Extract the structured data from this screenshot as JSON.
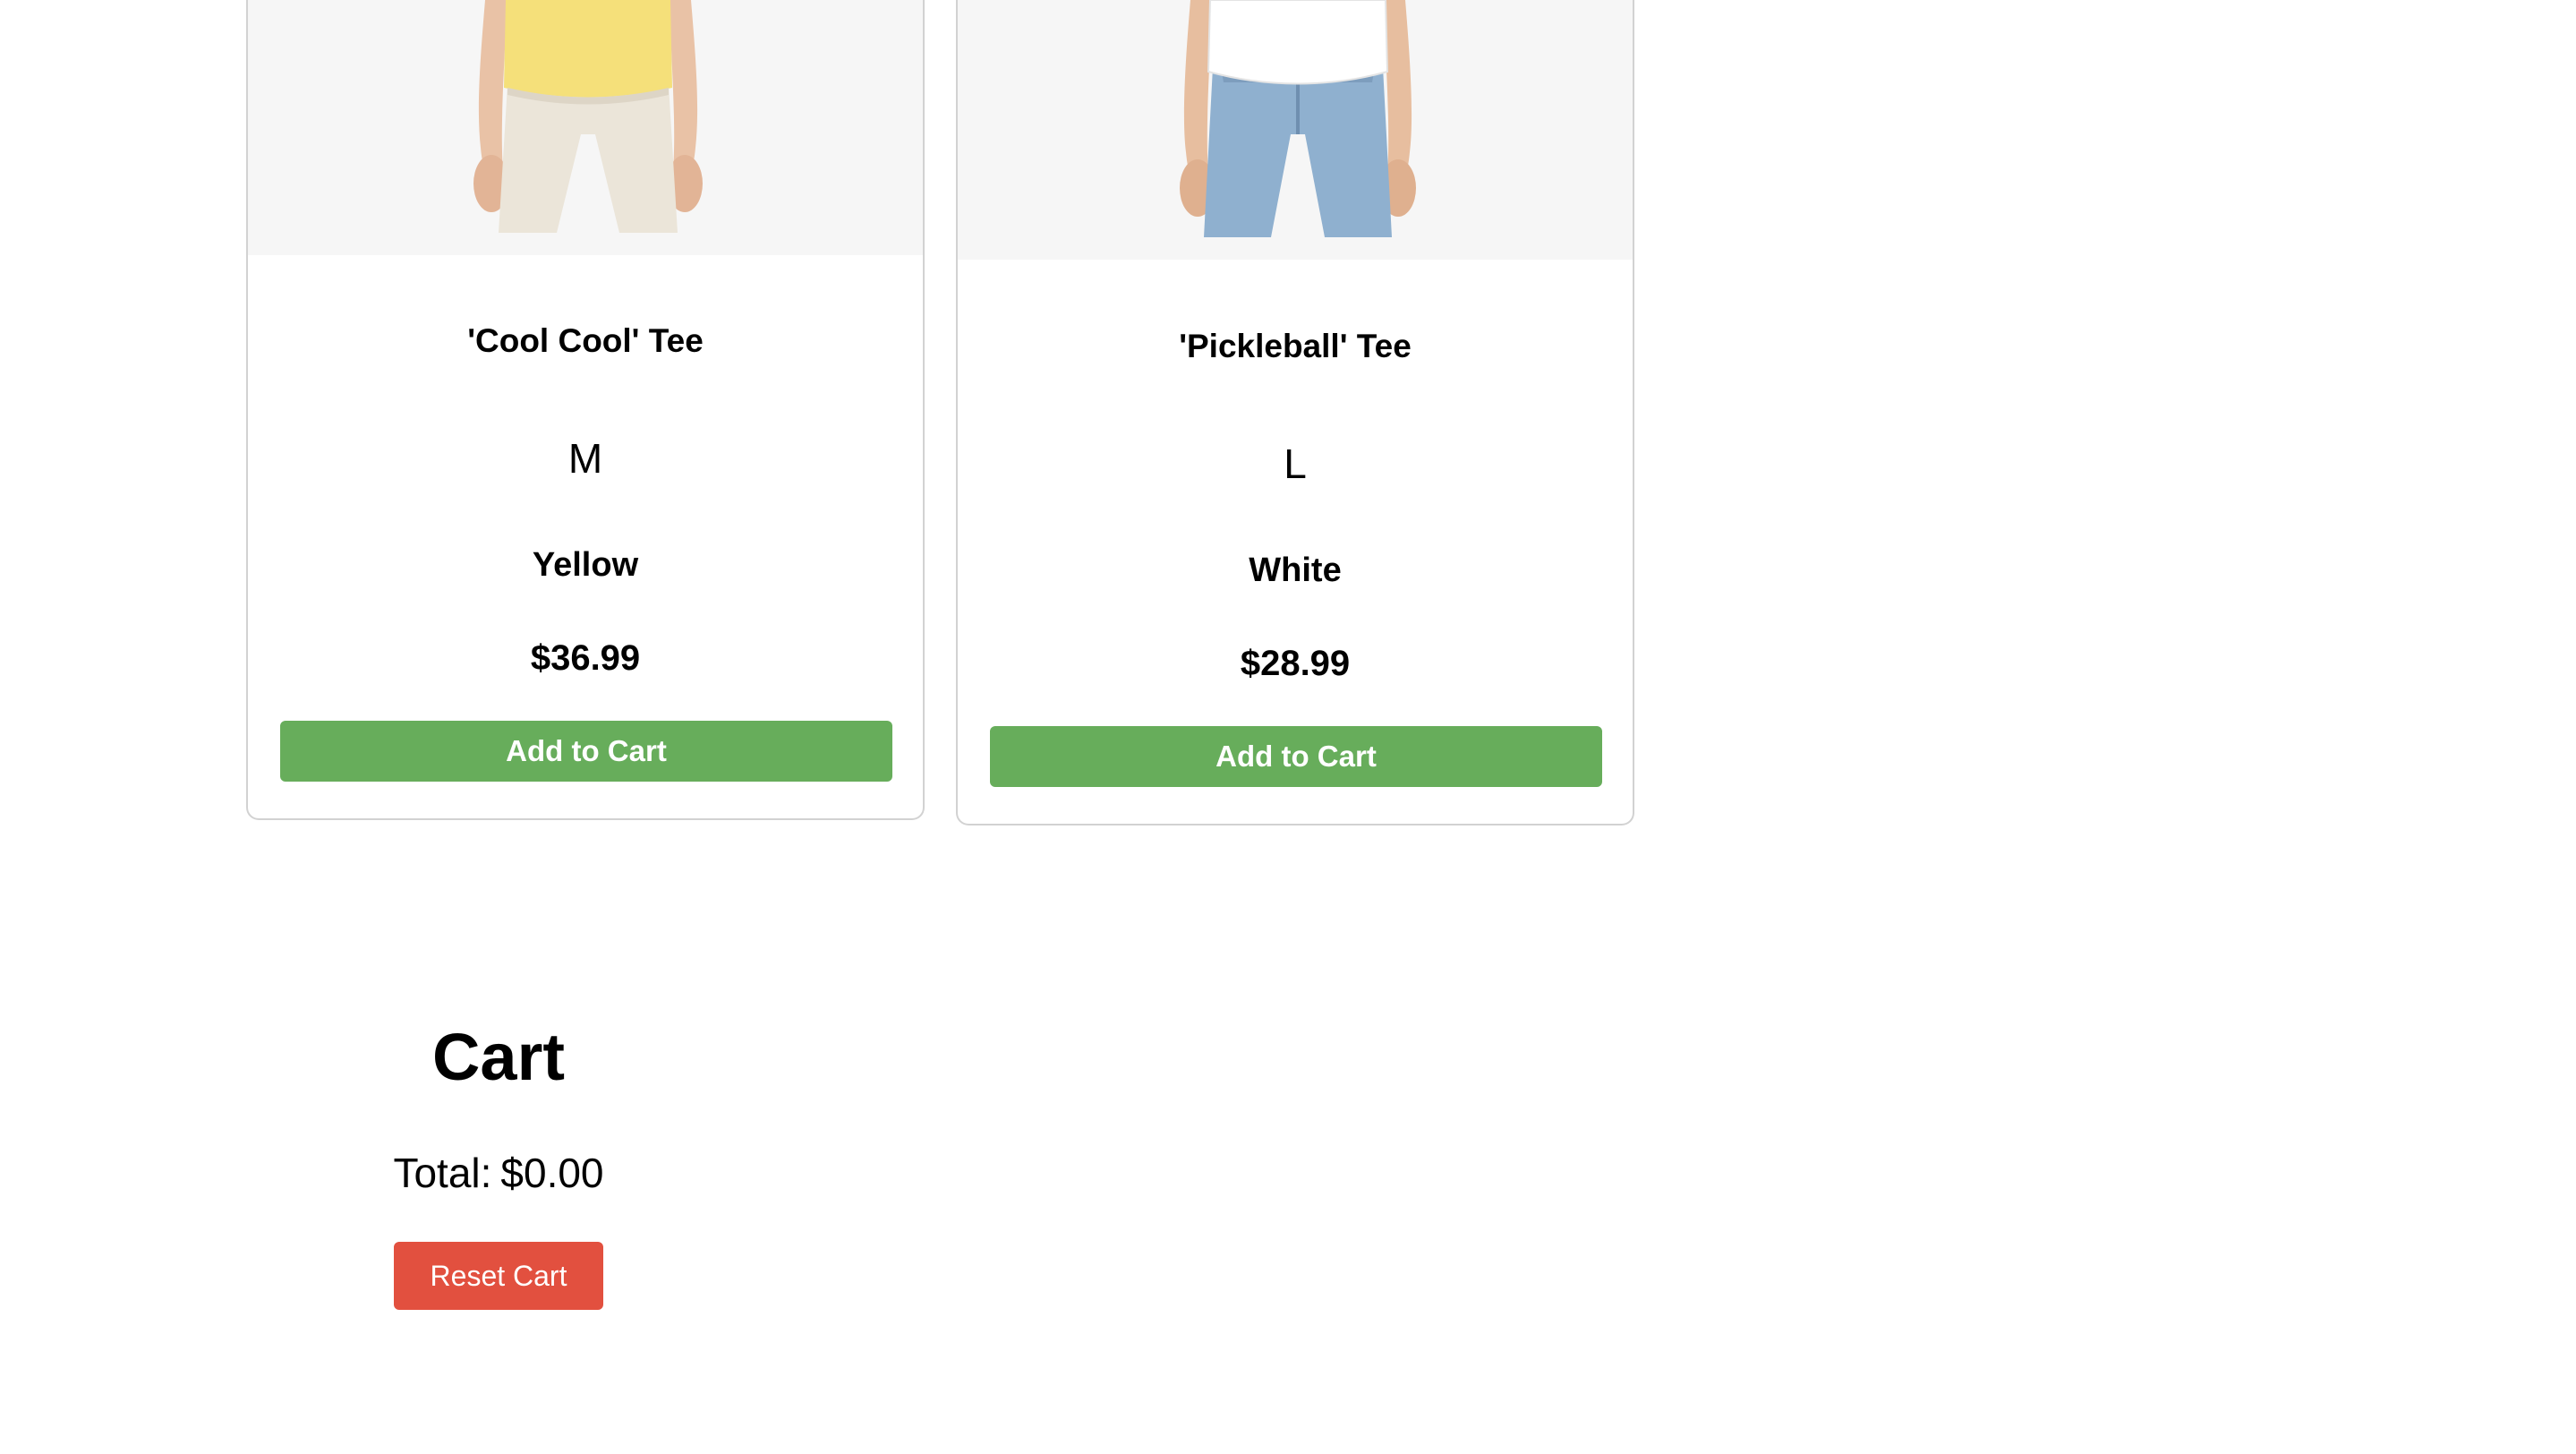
{
  "products": [
    {
      "name": "'Cool Cool' Tee",
      "size": "M",
      "color": "Yellow",
      "price": "$36.99",
      "add_label": "Add to Cart"
    },
    {
      "name": "'Pickleball' Tee",
      "size": "L",
      "color": "White",
      "price": "$28.99",
      "add_label": "Add to Cart"
    }
  ],
  "cart": {
    "title": "Cart",
    "total_label": "Total:",
    "total_value": "$0.00",
    "reset_label": "Reset Cart"
  },
  "colors": {
    "add_button": "#67ad5b",
    "reset_button": "#e2503f",
    "shirt_yellow": "#f5e07a",
    "shirt_white": "#ffffff"
  }
}
